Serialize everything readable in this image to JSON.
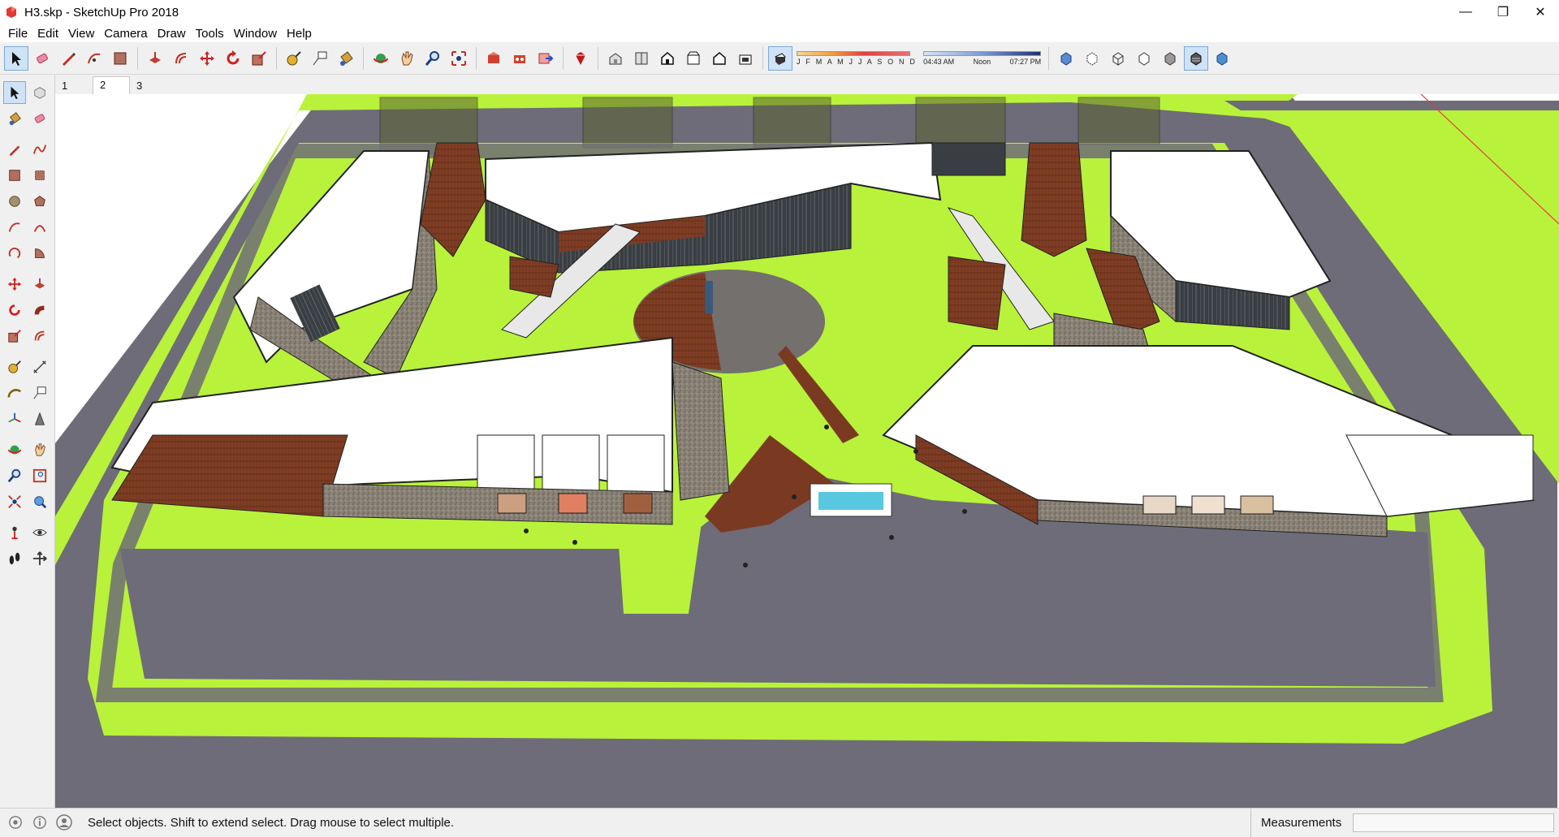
{
  "window": {
    "title": "H3.skp - SketchUp Pro 2018",
    "minimize": "—",
    "maximize": "❐",
    "close": "✕"
  },
  "menu": [
    "File",
    "Edit",
    "View",
    "Camera",
    "Draw",
    "Tools",
    "Window",
    "Help"
  ],
  "shadow": {
    "months": "J F M A M J J A S O N D",
    "time_start": "04:43 AM",
    "time_mid": "Noon",
    "time_end": "07:27 PM"
  },
  "scenes": {
    "tabs": [
      "1",
      "2",
      "3"
    ],
    "active": "2"
  },
  "status": {
    "hint": "Select objects. Shift to extend select. Drag mouse to select multiple.",
    "measurements_label": "Measurements",
    "measurements_value": ""
  },
  "colors": {
    "grass": "#b9f23a",
    "road": "#6e6c78",
    "roof": "#ffffff",
    "brick": "#7a3a22",
    "stone": "#8c8478",
    "water": "#58c8e0",
    "accent": "#cfe3f7"
  }
}
